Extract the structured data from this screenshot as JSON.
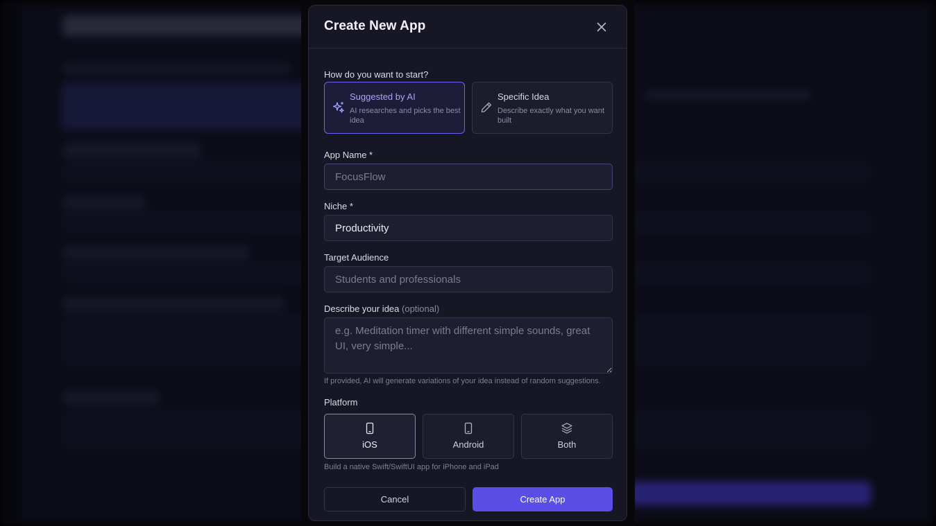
{
  "modal": {
    "title": "Create New App",
    "start_label": "How do you want to start?",
    "modes": [
      {
        "title": "Suggested by AI",
        "desc": "AI researches and picks the best idea",
        "icon": "sparkles-icon",
        "selected": true
      },
      {
        "title": "Specific Idea",
        "desc": "Describe exactly what you want built",
        "icon": "pencil-icon",
        "selected": false
      }
    ],
    "app_name": {
      "label": "App Name *",
      "placeholder": "FocusFlow",
      "value": ""
    },
    "niche": {
      "label": "Niche *",
      "value": "Productivity"
    },
    "audience": {
      "label": "Target Audience",
      "placeholder": "Students and professionals",
      "value": ""
    },
    "idea": {
      "label": "Describe your idea",
      "optional": "(optional)",
      "placeholder": "e.g. Meditation timer with different simple sounds, great UI, very simple...",
      "hint": "If provided, AI will generate variations of your idea instead of random suggestions."
    },
    "platform": {
      "label": "Platform",
      "options": [
        {
          "label": "iOS",
          "icon": "phone-icon",
          "selected": true
        },
        {
          "label": "Android",
          "icon": "phone-icon",
          "selected": false
        },
        {
          "label": "Both",
          "icon": "layers-icon",
          "selected": false
        }
      ],
      "hint": "Build a native Swift/SwiftUI app for iPhone and iPad"
    },
    "cancel_label": "Cancel",
    "create_label": "Create App"
  },
  "colors": {
    "accent": "#5b4ee6",
    "accent_text": "#a9a4ff",
    "modal_bg": "#161624",
    "field_bg": "#1e1e30"
  }
}
